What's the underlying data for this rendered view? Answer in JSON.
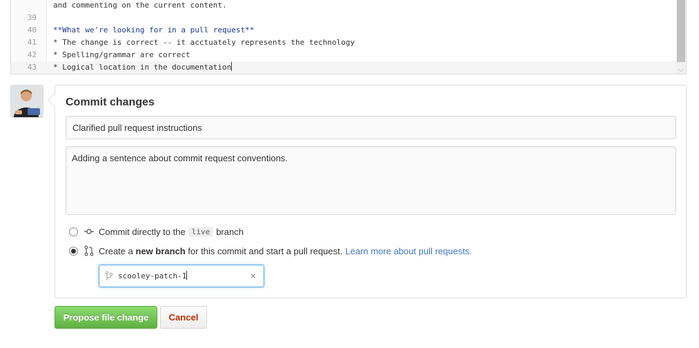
{
  "editor": {
    "lines": [
      {
        "num": "",
        "text": "and commenting on the current content.",
        "style": "plain"
      },
      {
        "num": "39",
        "text": "",
        "style": "plain"
      },
      {
        "num": "40",
        "text": "**What we're looking for in a pull request**",
        "style": "md"
      },
      {
        "num": "41",
        "text": "* The change is correct -- it acctuately represents the technology",
        "style": "plain"
      },
      {
        "num": "42",
        "text": "* Spelling/grammar are correct",
        "style": "plain"
      },
      {
        "num": "43",
        "text": "* Logical location in the documentation",
        "style": "plain"
      }
    ]
  },
  "commit": {
    "title": "Commit changes",
    "summary_value": "Clarified pull request instructions",
    "description_value": "Adding a sentence about commit request conventions.",
    "option_direct": {
      "prefix": "Commit directly to the",
      "branch": "live",
      "suffix": "branch"
    },
    "option_new": {
      "prefix": "Create a",
      "bold": "new branch",
      "suffix": "for this commit and start a pull request.",
      "link": "Learn more about pull requests."
    },
    "branch_name": "scooley-patch-1"
  },
  "actions": {
    "propose_label": "Propose file change",
    "cancel_label": "Cancel"
  },
  "icons": {
    "commit_icon": "git-commit-icon",
    "pull_request_icon": "git-pull-request-icon",
    "branch_icon": "git-branch-icon",
    "clear_icon": "close-icon"
  },
  "colors": {
    "primary_button": "#60b044",
    "cancel_text": "#bd2c00",
    "link": "#4078c0",
    "focus_border": "#51a7e8"
  }
}
